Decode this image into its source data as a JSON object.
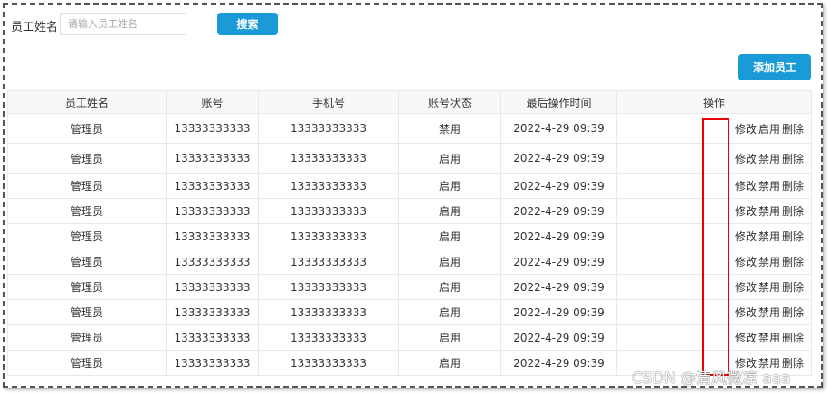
{
  "search": {
    "label": "员工姓名",
    "placeholder": "请输入员工姓名",
    "button": "搜索"
  },
  "add_button": "添加员工",
  "table": {
    "headers": [
      "员工姓名",
      "账号",
      "手机号",
      "账号状态",
      "最后操作时间",
      "操作"
    ],
    "rows": [
      {
        "name": "管理员",
        "account": "13333333333",
        "phone": "13333333333",
        "status": "禁用",
        "time": "2022-4-29 09:39",
        "edit": "修改",
        "toggle": "启用",
        "delete": "删除"
      },
      {
        "name": "管理员",
        "account": "13333333333",
        "phone": "13333333333",
        "status": "启用",
        "time": "2022-4-29 09:39",
        "edit": "修改",
        "toggle": "禁用",
        "delete": "删除"
      },
      {
        "name": "管理员",
        "account": "13333333333",
        "phone": "13333333333",
        "status": "启用",
        "time": "2022-4-29 09:39",
        "edit": "修改",
        "toggle": "禁用",
        "delete": "删除"
      },
      {
        "name": "管理员",
        "account": "13333333333",
        "phone": "13333333333",
        "status": "启用",
        "time": "2022-4-29 09:39",
        "edit": "修改",
        "toggle": "禁用",
        "delete": "删除"
      },
      {
        "name": "管理员",
        "account": "13333333333",
        "phone": "13333333333",
        "status": "启用",
        "time": "2022-4-29 09:39",
        "edit": "修改",
        "toggle": "禁用",
        "delete": "删除"
      },
      {
        "name": "管理员",
        "account": "13333333333",
        "phone": "13333333333",
        "status": "启用",
        "time": "2022-4-29 09:39",
        "edit": "修改",
        "toggle": "禁用",
        "delete": "删除"
      },
      {
        "name": "管理员",
        "account": "13333333333",
        "phone": "13333333333",
        "status": "启用",
        "time": "2022-4-29 09:39",
        "edit": "修改",
        "toggle": "禁用",
        "delete": "删除"
      },
      {
        "name": "管理员",
        "account": "13333333333",
        "phone": "13333333333",
        "status": "启用",
        "time": "2022-4-29 09:39",
        "edit": "修改",
        "toggle": "禁用",
        "delete": "删除"
      },
      {
        "name": "管理员",
        "account": "13333333333",
        "phone": "13333333333",
        "status": "启用",
        "time": "2022-4-29 09:39",
        "edit": "修改",
        "toggle": "禁用",
        "delete": "删除"
      },
      {
        "name": "管理员",
        "account": "13333333333",
        "phone": "13333333333",
        "status": "启用",
        "time": "2022-4-29 09:39",
        "edit": "修改",
        "toggle": "禁用",
        "delete": "删除"
      }
    ]
  },
  "watermark": "CSDN @清风微凉 aaa",
  "colors": {
    "primary": "#1a9bd7",
    "highlight": "#e00000"
  }
}
